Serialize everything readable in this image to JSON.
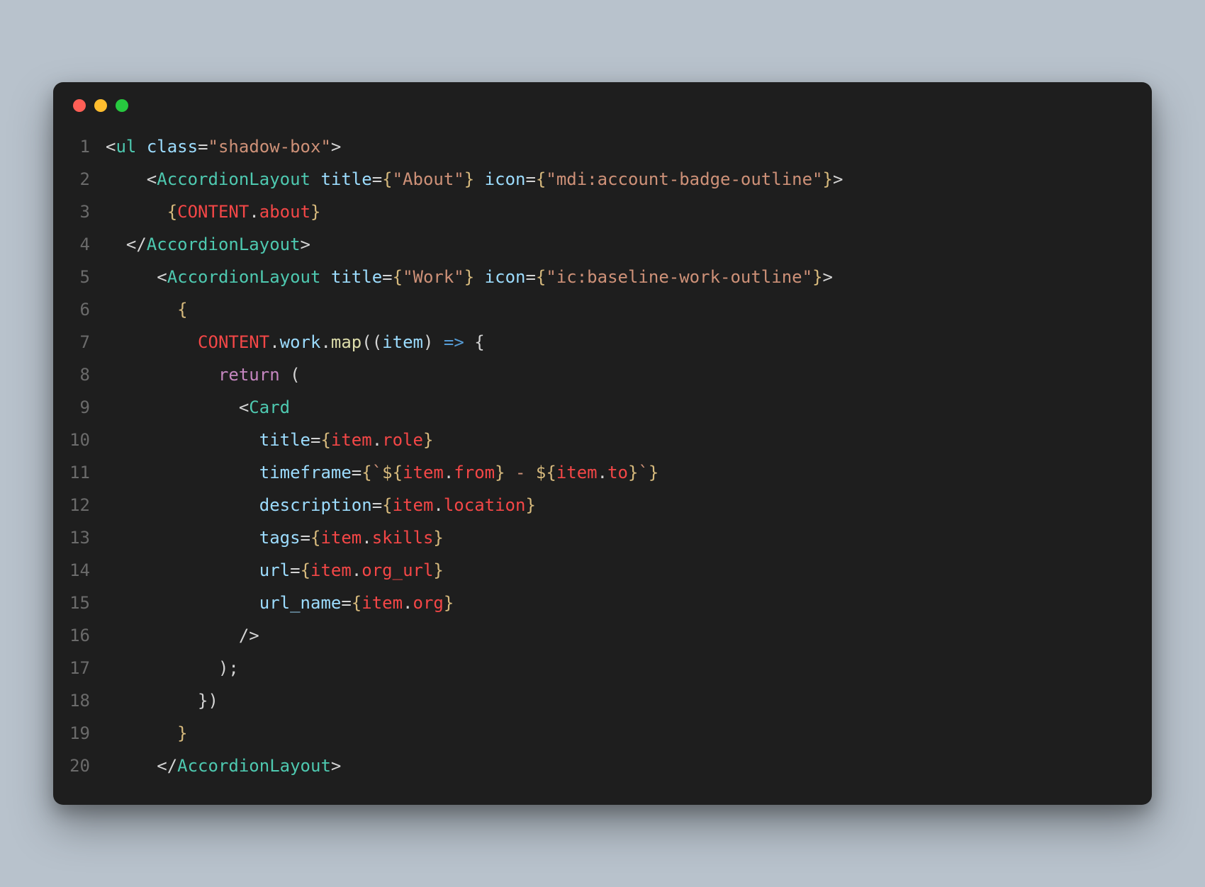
{
  "window": {
    "traffic_lights": [
      "red",
      "yellow",
      "green"
    ]
  },
  "gutter": [
    "1",
    "2",
    "3",
    "4",
    "5",
    "6",
    "7",
    "8",
    "9",
    "10",
    "11",
    "12",
    "13",
    "14",
    "15",
    "16",
    "17",
    "18",
    "19",
    "20"
  ],
  "code": {
    "lines": [
      [
        {
          "c": "br",
          "t": "<"
        },
        {
          "c": "tag",
          "t": "ul"
        },
        {
          "c": "br",
          "t": " "
        },
        {
          "c": "attr",
          "t": "class"
        },
        {
          "c": "op",
          "t": "="
        },
        {
          "c": "str",
          "t": "\"shadow-box\""
        },
        {
          "c": "br",
          "t": ">"
        }
      ],
      [
        {
          "c": "br",
          "t": "    <"
        },
        {
          "c": "tag",
          "t": "AccordionLayout"
        },
        {
          "c": "br",
          "t": " "
        },
        {
          "c": "attr",
          "t": "title"
        },
        {
          "c": "op",
          "t": "="
        },
        {
          "c": "gold",
          "t": "{"
        },
        {
          "c": "str",
          "t": "\"About\""
        },
        {
          "c": "gold",
          "t": "}"
        },
        {
          "c": "br",
          "t": " "
        },
        {
          "c": "attr",
          "t": "icon"
        },
        {
          "c": "op",
          "t": "="
        },
        {
          "c": "gold",
          "t": "{"
        },
        {
          "c": "str",
          "t": "\"mdi:account-badge-outline\""
        },
        {
          "c": "gold",
          "t": "}"
        },
        {
          "c": "br",
          "t": ">"
        }
      ],
      [
        {
          "c": "br",
          "t": "      "
        },
        {
          "c": "gold",
          "t": "{"
        },
        {
          "c": "red",
          "t": "CONTENT"
        },
        {
          "c": "br",
          "t": "."
        },
        {
          "c": "red",
          "t": "about"
        },
        {
          "c": "gold",
          "t": "}"
        }
      ],
      [
        {
          "c": "br",
          "t": "  </"
        },
        {
          "c": "tag",
          "t": "AccordionLayout"
        },
        {
          "c": "br",
          "t": ">"
        }
      ],
      [
        {
          "c": "br",
          "t": "     <"
        },
        {
          "c": "tag",
          "t": "AccordionLayout"
        },
        {
          "c": "br",
          "t": " "
        },
        {
          "c": "attr",
          "t": "title"
        },
        {
          "c": "op",
          "t": "="
        },
        {
          "c": "gold",
          "t": "{"
        },
        {
          "c": "str",
          "t": "\"Work\""
        },
        {
          "c": "gold",
          "t": "}"
        },
        {
          "c": "br",
          "t": " "
        },
        {
          "c": "attr",
          "t": "icon"
        },
        {
          "c": "op",
          "t": "="
        },
        {
          "c": "gold",
          "t": "{"
        },
        {
          "c": "str",
          "t": "\"ic:baseline-work-outline\""
        },
        {
          "c": "gold",
          "t": "}"
        },
        {
          "c": "br",
          "t": ">"
        }
      ],
      [
        {
          "c": "br",
          "t": "       "
        },
        {
          "c": "gold",
          "t": "{"
        }
      ],
      [
        {
          "c": "br",
          "t": "         "
        },
        {
          "c": "red",
          "t": "CONTENT"
        },
        {
          "c": "br",
          "t": "."
        },
        {
          "c": "attr",
          "t": "work"
        },
        {
          "c": "br",
          "t": "."
        },
        {
          "c": "fun",
          "t": "map"
        },
        {
          "c": "br",
          "t": "(("
        },
        {
          "c": "param",
          "t": "item"
        },
        {
          "c": "br",
          "t": ") "
        },
        {
          "c": "arrow",
          "t": "=>"
        },
        {
          "c": "br",
          "t": " {"
        }
      ],
      [
        {
          "c": "br",
          "t": "           "
        },
        {
          "c": "kw",
          "t": "return"
        },
        {
          "c": "br",
          "t": " ("
        }
      ],
      [
        {
          "c": "br",
          "t": "             <"
        },
        {
          "c": "tag",
          "t": "Card"
        }
      ],
      [
        {
          "c": "br",
          "t": "               "
        },
        {
          "c": "attr",
          "t": "title"
        },
        {
          "c": "op",
          "t": "="
        },
        {
          "c": "gold",
          "t": "{"
        },
        {
          "c": "red",
          "t": "item"
        },
        {
          "c": "br",
          "t": "."
        },
        {
          "c": "red",
          "t": "role"
        },
        {
          "c": "gold",
          "t": "}"
        }
      ],
      [
        {
          "c": "br",
          "t": "               "
        },
        {
          "c": "attr",
          "t": "timeframe"
        },
        {
          "c": "op",
          "t": "="
        },
        {
          "c": "gold",
          "t": "{"
        },
        {
          "c": "tmpl",
          "t": "`"
        },
        {
          "c": "gold",
          "t": "${"
        },
        {
          "c": "red",
          "t": "item"
        },
        {
          "c": "br",
          "t": "."
        },
        {
          "c": "red",
          "t": "from"
        },
        {
          "c": "gold",
          "t": "}"
        },
        {
          "c": "tmpl",
          "t": " - "
        },
        {
          "c": "gold",
          "t": "${"
        },
        {
          "c": "red",
          "t": "item"
        },
        {
          "c": "br",
          "t": "."
        },
        {
          "c": "red",
          "t": "to"
        },
        {
          "c": "gold",
          "t": "}"
        },
        {
          "c": "tmpl",
          "t": "`"
        },
        {
          "c": "gold",
          "t": "}"
        }
      ],
      [
        {
          "c": "br",
          "t": "               "
        },
        {
          "c": "attr",
          "t": "description"
        },
        {
          "c": "op",
          "t": "="
        },
        {
          "c": "gold",
          "t": "{"
        },
        {
          "c": "red",
          "t": "item"
        },
        {
          "c": "br",
          "t": "."
        },
        {
          "c": "red",
          "t": "location"
        },
        {
          "c": "gold",
          "t": "}"
        }
      ],
      [
        {
          "c": "br",
          "t": "               "
        },
        {
          "c": "attr",
          "t": "tags"
        },
        {
          "c": "op",
          "t": "="
        },
        {
          "c": "gold",
          "t": "{"
        },
        {
          "c": "red",
          "t": "item"
        },
        {
          "c": "br",
          "t": "."
        },
        {
          "c": "red",
          "t": "skills"
        },
        {
          "c": "gold",
          "t": "}"
        }
      ],
      [
        {
          "c": "br",
          "t": "               "
        },
        {
          "c": "attr",
          "t": "url"
        },
        {
          "c": "op",
          "t": "="
        },
        {
          "c": "gold",
          "t": "{"
        },
        {
          "c": "red",
          "t": "item"
        },
        {
          "c": "br",
          "t": "."
        },
        {
          "c": "red",
          "t": "org_url"
        },
        {
          "c": "gold",
          "t": "}"
        }
      ],
      [
        {
          "c": "br",
          "t": "               "
        },
        {
          "c": "attr",
          "t": "url_name"
        },
        {
          "c": "op",
          "t": "="
        },
        {
          "c": "gold",
          "t": "{"
        },
        {
          "c": "red",
          "t": "item"
        },
        {
          "c": "br",
          "t": "."
        },
        {
          "c": "red",
          "t": "org"
        },
        {
          "c": "gold",
          "t": "}"
        }
      ],
      [
        {
          "c": "br",
          "t": "             />"
        }
      ],
      [
        {
          "c": "br",
          "t": "           );"
        }
      ],
      [
        {
          "c": "br",
          "t": "         })"
        }
      ],
      [
        {
          "c": "br",
          "t": "       "
        },
        {
          "c": "gold",
          "t": "}"
        }
      ],
      [
        {
          "c": "br",
          "t": "     </"
        },
        {
          "c": "tag",
          "t": "AccordionLayout"
        },
        {
          "c": "br",
          "t": ">"
        }
      ]
    ]
  }
}
